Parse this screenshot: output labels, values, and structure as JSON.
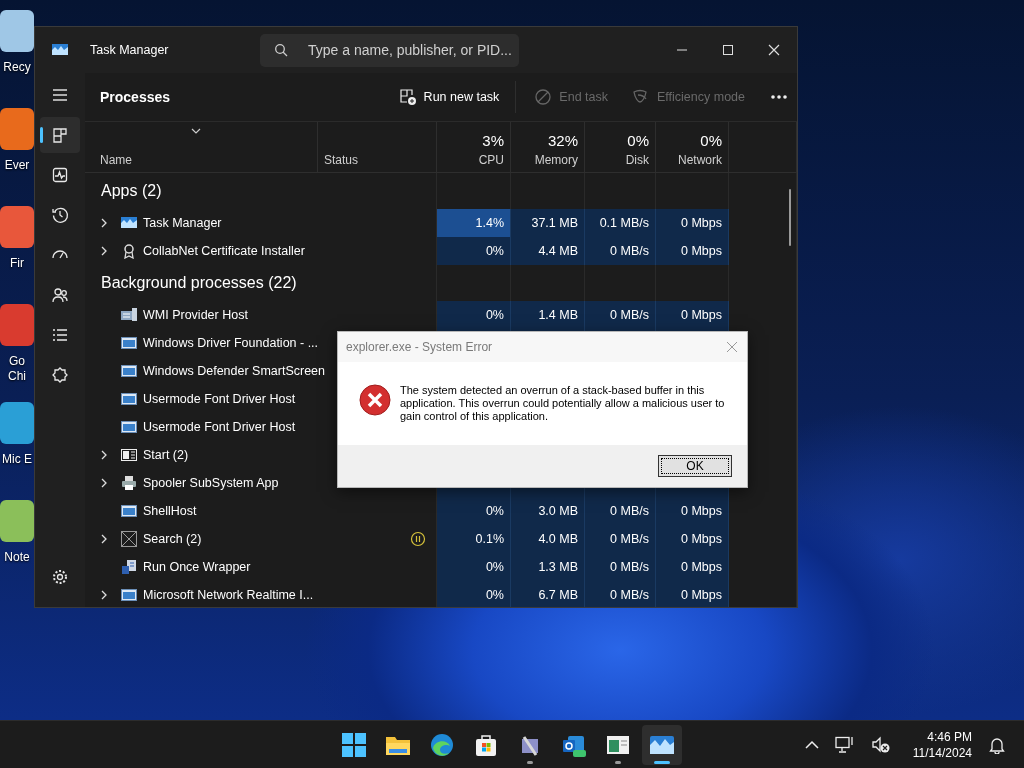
{
  "desktop_icons": [
    {
      "kind": "recycle",
      "label": "Recy"
    },
    {
      "kind": "orange",
      "label": "Ever"
    },
    {
      "kind": "fox",
      "label": "Fir"
    },
    {
      "kind": "chrome",
      "label": "Go Chi"
    },
    {
      "kind": "edge",
      "label": "Mic E"
    },
    {
      "kind": "notepad",
      "label": "Note"
    }
  ],
  "task_manager": {
    "title": "Task Manager",
    "search": {
      "placeholder": "Type a name, publisher, or PID..."
    },
    "nav": [
      {
        "kind": "processes",
        "selected": true
      },
      {
        "kind": "performance",
        "selected": false
      },
      {
        "kind": "history",
        "selected": false
      },
      {
        "kind": "startup",
        "selected": false
      },
      {
        "kind": "users",
        "selected": false
      },
      {
        "kind": "details",
        "selected": false
      },
      {
        "kind": "services",
        "selected": false
      }
    ],
    "page_title": "Processes",
    "toolbar": [
      {
        "kind": "run",
        "label": "Run new task",
        "disabled": false
      },
      {
        "kind": "end",
        "label": "End task",
        "disabled": true
      },
      {
        "kind": "eff",
        "label": "Efficiency mode",
        "disabled": true
      }
    ],
    "columns": [
      {
        "label": "Name"
      },
      {
        "label": "Status"
      },
      {
        "usage": "3%",
        "label": "CPU"
      },
      {
        "usage": "32%",
        "label": "Memory"
      },
      {
        "usage": "0%",
        "label": "Disk"
      },
      {
        "usage": "0%",
        "label": "Network"
      }
    ],
    "groups": [
      {
        "title": "Apps (2)",
        "rows": [
          {
            "kind": "taskmgr",
            "name": "Task Manager",
            "expandable": true,
            "suspended": false,
            "cpu_high": true,
            "cpu": "1.4%",
            "memory": "37.1 MB",
            "disk": "0.1 MB/s",
            "network": "0 Mbps"
          },
          {
            "kind": "cert",
            "name": "CollabNet Certificate Installer",
            "expandable": true,
            "suspended": false,
            "cpu_high": false,
            "cpu": "0%",
            "memory": "4.4 MB",
            "disk": "0 MB/s",
            "network": "0 Mbps"
          }
        ]
      },
      {
        "title": "Background processes (22)",
        "rows": [
          {
            "kind": "wmi",
            "name": "WMI Provider Host",
            "expandable": false,
            "suspended": false,
            "cpu_high": false,
            "cpu": "0%",
            "memory": "1.4 MB",
            "disk": "0 MB/s",
            "network": "0 Mbps"
          },
          {
            "kind": "window",
            "name": "Windows Driver Foundation - ...",
            "expandable": false
          },
          {
            "kind": "window",
            "name": "Windows Defender SmartScreen",
            "expandable": false
          },
          {
            "kind": "window",
            "name": "Usermode Font Driver Host",
            "expandable": false
          },
          {
            "kind": "window",
            "name": "Usermode Font Driver Host",
            "expandable": false
          },
          {
            "kind": "start",
            "name": "Start (2)",
            "expandable": true
          },
          {
            "kind": "printer",
            "name": "Spooler SubSystem App",
            "expandable": true,
            "cpu_high": false
          },
          {
            "kind": "window",
            "name": "ShellHost",
            "expandable": false,
            "suspended": false,
            "cpu_high": false,
            "cpu": "0%",
            "memory": "3.0 MB",
            "disk": "0 MB/s",
            "network": "0 Mbps"
          },
          {
            "kind": "search",
            "name": "Search (2)",
            "expandable": true,
            "suspended": true,
            "cpu_high": false,
            "cpu": "0.1%",
            "memory": "4.0 MB",
            "disk": "0 MB/s",
            "network": "0 Mbps"
          },
          {
            "kind": "runonce",
            "name": "Run Once Wrapper",
            "expandable": false,
            "suspended": false,
            "cpu_high": false,
            "cpu": "0%",
            "memory": "1.3 MB",
            "disk": "0 MB/s",
            "network": "0 Mbps"
          },
          {
            "kind": "window",
            "name": "Microsoft Network Realtime I...",
            "expandable": true,
            "suspended": false,
            "cpu_high": false,
            "cpu": "0%",
            "memory": "6.7 MB",
            "disk": "0 MB/s",
            "network": "0 Mbps"
          }
        ]
      }
    ]
  },
  "dialog": {
    "title": "explorer.exe - System Error",
    "message": "The system detected an overrun of a stack-based buffer in this application. This overrun could potentially allow a malicious user to gain control of this application.",
    "button": "OK"
  },
  "taskbar": {
    "apps": [
      {
        "kind": "start",
        "running": false,
        "selected": false
      },
      {
        "kind": "folder",
        "running": false,
        "selected": false
      },
      {
        "kind": "edge",
        "running": false,
        "selected": false
      },
      {
        "kind": "store",
        "running": false,
        "selected": false
      },
      {
        "kind": "tool",
        "running": true,
        "selected": false
      },
      {
        "kind": "mail",
        "running": false,
        "selected": false
      },
      {
        "kind": "doc",
        "running": true,
        "selected": false
      },
      {
        "kind": "taskmgr",
        "running": true,
        "selected": true
      }
    ],
    "time": "4:46 PM",
    "date": "11/14/2024"
  }
}
